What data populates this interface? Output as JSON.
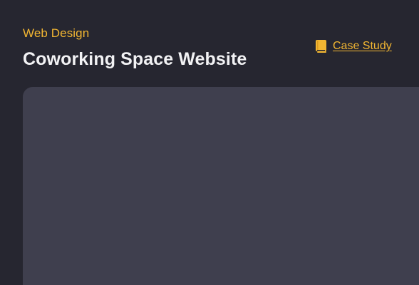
{
  "project": {
    "category": "Web Design",
    "title": "Coworking Space Website"
  },
  "case_study_link": {
    "label": "Case Study",
    "icon": "book-icon"
  },
  "preview": {
    "content": ""
  },
  "colors": {
    "background": "#262630",
    "accent": "#f2b632",
    "title_text": "#f2f2f4",
    "preview_panel": "#3f3f4e"
  }
}
